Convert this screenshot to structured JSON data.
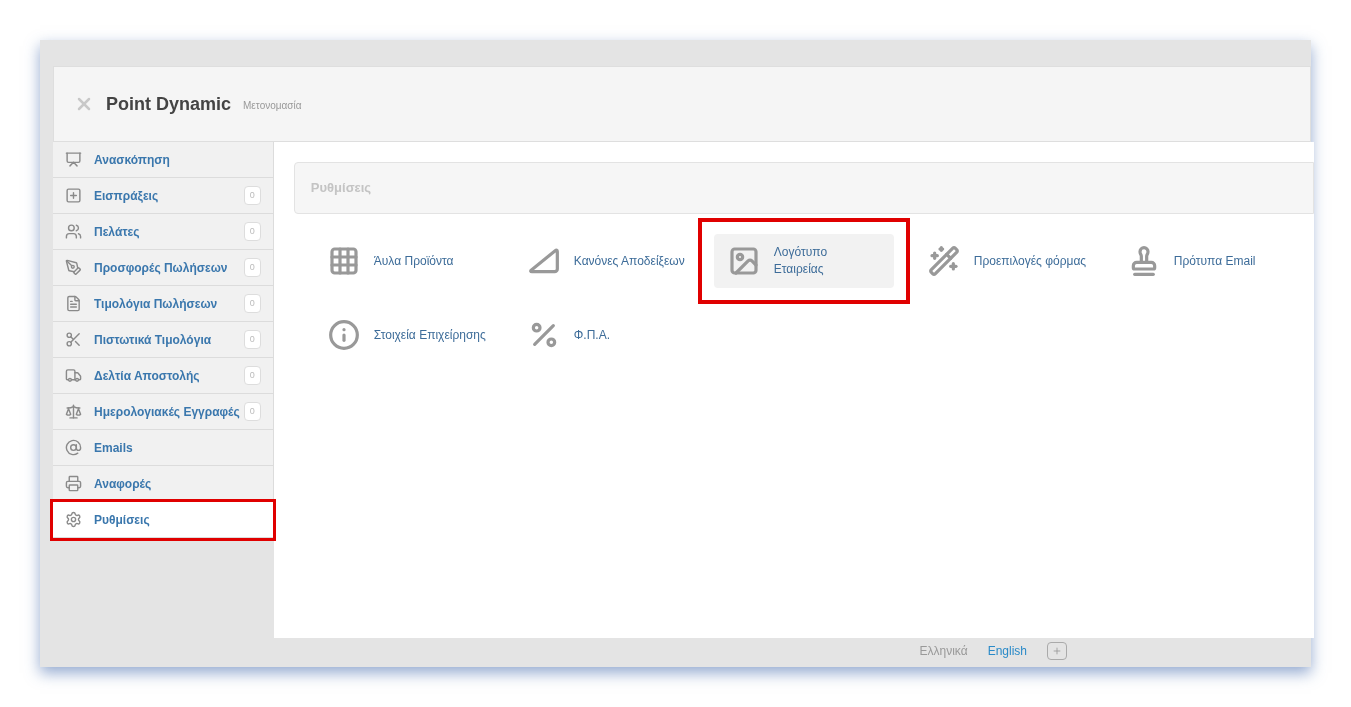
{
  "header": {
    "title": "Point Dynamic",
    "rename_link": "Μετονομασία"
  },
  "sidebar": {
    "items": [
      {
        "label": "Ανασκόπηση",
        "selected": false,
        "highlighted": false
      },
      {
        "label": "Εισπράξεις",
        "count": "0",
        "selected": false,
        "highlighted": false
      },
      {
        "label": "Πελάτες",
        "count": "0",
        "selected": false,
        "highlighted": false
      },
      {
        "label": "Προσφορές Πωλήσεων",
        "count": "0",
        "selected": false,
        "highlighted": false
      },
      {
        "label": "Τιμολόγια Πωλήσεων",
        "count": "0",
        "selected": false,
        "highlighted": false
      },
      {
        "label": "Πιστωτικά Τιμολόγια",
        "count": "0",
        "selected": false,
        "highlighted": false
      },
      {
        "label": "Δελτία Αποστολής",
        "count": "0",
        "selected": false,
        "highlighted": false
      },
      {
        "label": "Ημερολογιακές Εγγραφές",
        "count": "0",
        "selected": false,
        "highlighted": false
      },
      {
        "label": "Emails",
        "selected": false,
        "highlighted": false
      },
      {
        "label": "Αναφορές",
        "selected": false,
        "highlighted": false
      },
      {
        "label": "Ρυθμίσεις",
        "selected": true,
        "highlighted": true
      }
    ]
  },
  "content": {
    "breadcrumb": "Ρυθμίσεις",
    "tiles": [
      {
        "label": "Άυλα Προϊόντα",
        "selected": false,
        "highlighted": false
      },
      {
        "label": "Κανόνες Αποδείξεων",
        "selected": false,
        "highlighted": false
      },
      {
        "label": "Λογότυπο Εταιρείας",
        "selected": true,
        "highlighted": true
      },
      {
        "label": "Προεπιλογές φόρμας",
        "selected": false,
        "highlighted": false
      },
      {
        "label": "Πρότυπα Email",
        "selected": false,
        "highlighted": false
      },
      {
        "label": "Στοιχεία Επιχείρησης",
        "selected": false,
        "highlighted": false
      },
      {
        "label": "Φ.Π.Α.",
        "selected": false,
        "highlighted": false
      }
    ]
  },
  "footer": {
    "languages": [
      {
        "label": "Ελληνικά",
        "selected": true
      },
      {
        "label": "English",
        "selected": false
      }
    ]
  }
}
